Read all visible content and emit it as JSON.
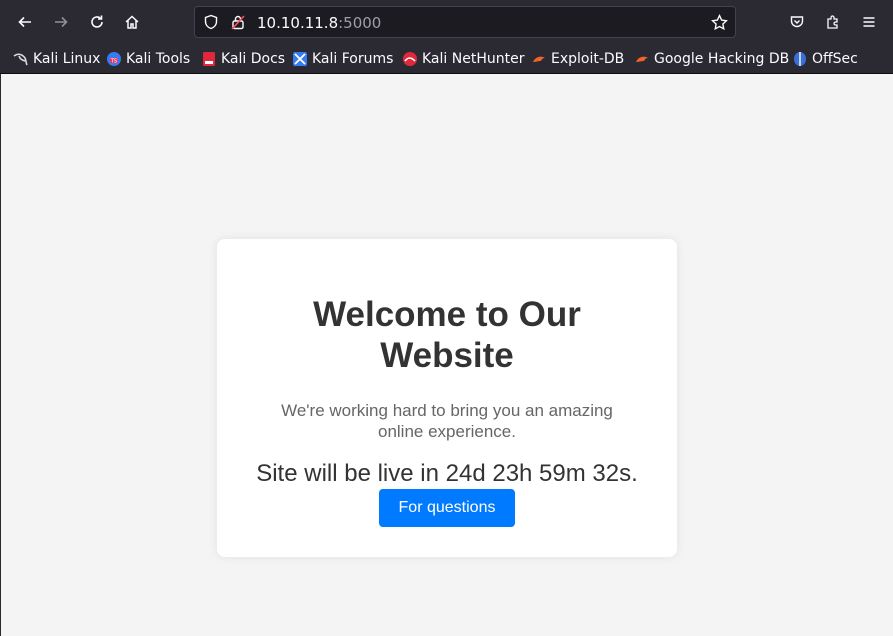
{
  "browser": {
    "url_host": "10.10.11.8",
    "url_port": ":5000",
    "bookmarks": [
      {
        "label": "Kali Linux",
        "icon": "kali-dragon-icon"
      },
      {
        "label": "Kali Tools",
        "icon": "kali-tools-icon"
      },
      {
        "label": "Kali Docs",
        "icon": "kali-docs-icon"
      },
      {
        "label": "Kali Forums",
        "icon": "kali-forums-icon"
      },
      {
        "label": "Kali NetHunter",
        "icon": "kali-nethunter-icon"
      },
      {
        "label": "Exploit-DB",
        "icon": "exploit-db-icon"
      },
      {
        "label": "Google Hacking DB",
        "icon": "ghdb-icon"
      },
      {
        "label": "OffSec",
        "icon": "offsec-icon"
      }
    ]
  },
  "page": {
    "title": "Welcome to Our Website",
    "description": "We're working hard to bring you an amazing online experience.",
    "countdown": "Site will be live in 24d 23h 59m 32s.",
    "button_label": "For questions"
  },
  "colors": {
    "button": "#007bff",
    "page_bg": "#f4f4f4",
    "chrome_bg": "#2b2a33"
  }
}
